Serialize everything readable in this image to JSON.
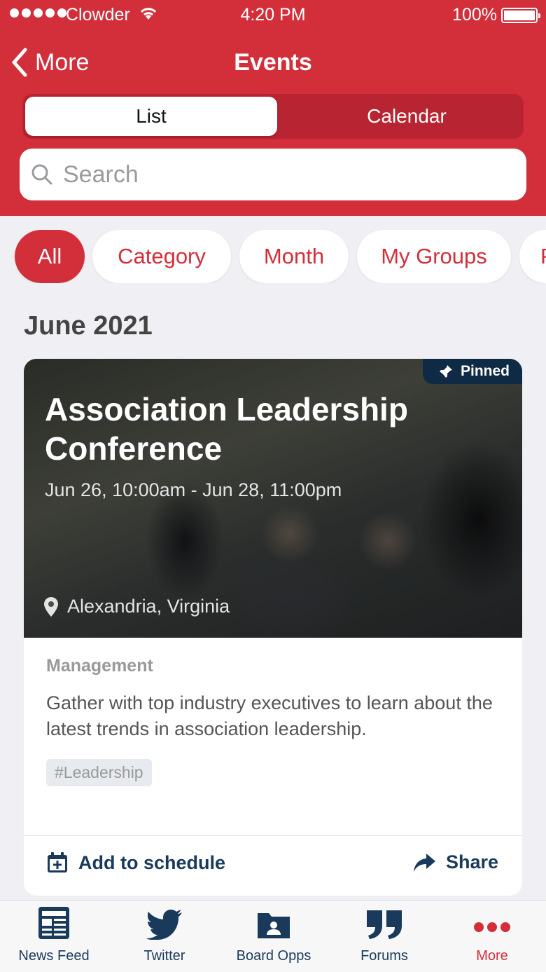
{
  "status_bar": {
    "carrier": "Clowder",
    "time": "4:20 PM",
    "battery": "100%"
  },
  "nav": {
    "back_label": "More",
    "title": "Events"
  },
  "view_toggle": {
    "options": [
      "List",
      "Calendar"
    ],
    "selected": "List"
  },
  "search": {
    "placeholder": "Search"
  },
  "filters": [
    "All",
    "Category",
    "Month",
    "My Groups",
    "P"
  ],
  "active_filter": "All",
  "section_heading": "June 2021",
  "event": {
    "badge": "Pinned",
    "title": "Association Leadership Conference",
    "dates": "Jun 26, 10:00am - Jun 28, 11:00pm",
    "location": "Alexandria, Virginia",
    "category": "Management",
    "description": "Gather with top industry executives to learn about the latest trends in association leadership.",
    "tag": "#Leadership",
    "add_label": "Add to schedule",
    "share_label": "Share"
  },
  "tabbar": {
    "items": [
      {
        "label": "News Feed",
        "icon": "news-feed-icon"
      },
      {
        "label": "Twitter",
        "icon": "twitter-icon"
      },
      {
        "label": "Board Opps",
        "icon": "board-opps-icon"
      },
      {
        "label": "Forums",
        "icon": "forums-icon"
      },
      {
        "label": "More",
        "icon": "more-icon"
      }
    ],
    "active": "More"
  },
  "colors": {
    "brand_red": "#d32f3a",
    "navy": "#1a3a5c",
    "pinned_badge": "#0f2a44"
  }
}
